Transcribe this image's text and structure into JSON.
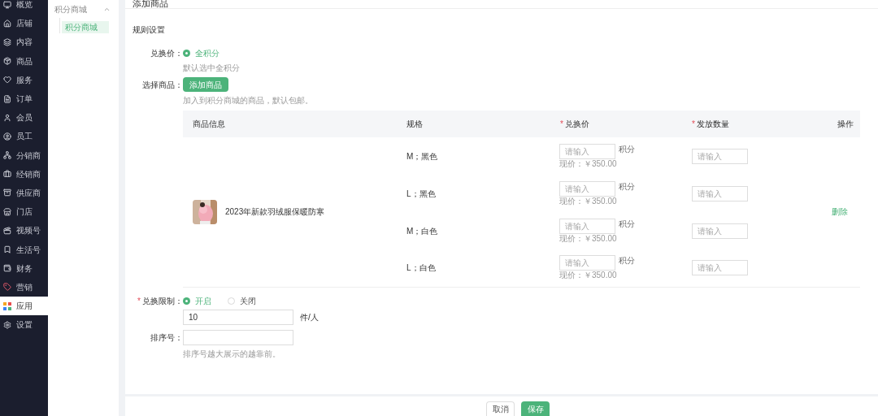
{
  "sidebar": {
    "items": [
      {
        "label": "概览",
        "selected": false
      },
      {
        "label": "店铺",
        "selected": false
      },
      {
        "label": "内容",
        "selected": false
      },
      {
        "label": "商品",
        "selected": false
      },
      {
        "label": "服务",
        "selected": false
      },
      {
        "label": "订单",
        "selected": false
      },
      {
        "label": "会员",
        "selected": false
      },
      {
        "label": "员工",
        "selected": false
      },
      {
        "label": "分销商",
        "selected": false
      },
      {
        "label": "经销商",
        "selected": false
      },
      {
        "label": "供应商",
        "selected": false
      },
      {
        "label": "门店",
        "selected": false
      },
      {
        "label": "视频号",
        "selected": false
      },
      {
        "label": "生活号",
        "selected": false
      },
      {
        "label": "财务",
        "selected": false
      },
      {
        "label": "营销",
        "selected": false
      },
      {
        "label": "应用",
        "selected": true
      },
      {
        "label": "设置",
        "selected": false
      }
    ]
  },
  "submenu": {
    "group": {
      "label": "积分商城",
      "expanded": true
    },
    "items": [
      {
        "label": "积分商城",
        "selected": true
      }
    ]
  },
  "page": {
    "title": "添加商品"
  },
  "section_title": "规则设置",
  "exchange_price": {
    "label": "兑换价：",
    "options": [
      {
        "label": "全积分",
        "selected": true
      }
    ],
    "hint": "默认选中全积分"
  },
  "select_product": {
    "label": "选择商品：",
    "button": "添加商品",
    "hint": "加入到积分商城的商品，默认包邮。"
  },
  "table": {
    "columns": [
      {
        "label": "商品信息"
      },
      {
        "label": "规格"
      },
      {
        "label": "兑换价",
        "required_mark": "*"
      },
      {
        "label": "发放数量",
        "required_mark": "*"
      },
      {
        "label": "操作"
      }
    ],
    "product": {
      "name": "2023年新款羽绒服保暖防寒"
    },
    "rows": [
      {
        "spec": "M；黑色",
        "price_placeholder": "请输入",
        "price_unit": "积分",
        "current_price": "现价：￥350.00",
        "quantity_placeholder": "请输入"
      },
      {
        "spec": "L；黑色",
        "price_placeholder": "请输入",
        "price_unit": "积分",
        "current_price": "现价：￥350.00",
        "quantity_placeholder": "请输入"
      },
      {
        "spec": "M；白色",
        "price_placeholder": "请输入",
        "price_unit": "积分",
        "current_price": "现价：￥350.00",
        "quantity_placeholder": "请输入"
      },
      {
        "spec": "L；白色",
        "price_placeholder": "请输入",
        "price_unit": "积分",
        "current_price": "现价：￥350.00",
        "quantity_placeholder": "请输入"
      }
    ],
    "action": "删除"
  },
  "limit": {
    "label": "兑换限制：",
    "required_mark": "*",
    "options": [
      {
        "label": "开启",
        "selected": true
      },
      {
        "label": "关闭",
        "selected": false
      }
    ],
    "value": "10",
    "unit": "件/人"
  },
  "sort": {
    "label": "排序号：",
    "hint": "排序号越大展示的越靠前。"
  },
  "footer": {
    "buttons": [
      {
        "label": "取消",
        "kind": "secondary"
      },
      {
        "label": "保存",
        "kind": "primary"
      }
    ]
  }
}
